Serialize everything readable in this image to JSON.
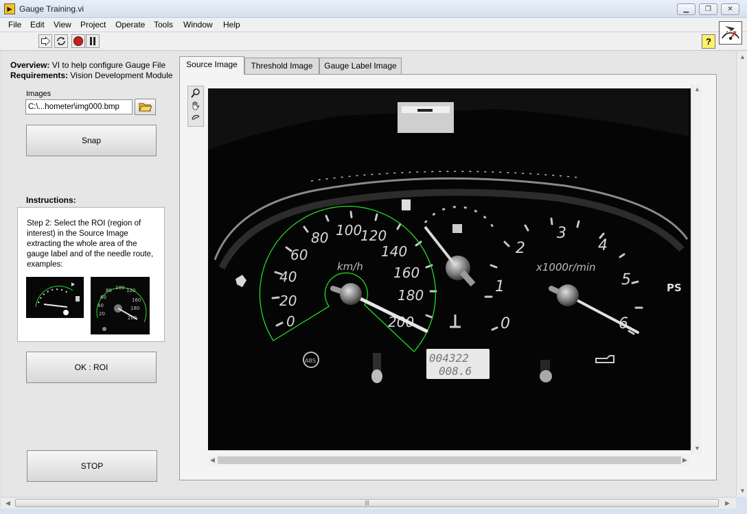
{
  "window": {
    "title": "Gauge Training.vi",
    "app_icon": "labview-icon"
  },
  "menu": [
    "File",
    "Edit",
    "View",
    "Project",
    "Operate",
    "Tools",
    "Window",
    "Help"
  ],
  "toolbar": {
    "buttons": [
      "run-icon",
      "run-continuously-icon",
      "abort-icon",
      "pause-icon"
    ],
    "help_glyph": "?"
  },
  "overview": {
    "overview_label": "Overview:",
    "overview_text": " VI to help configure Gauge File",
    "requirements_label": "Requirements:",
    "requirements_text": " Vision Development Module"
  },
  "images": {
    "label": "Images",
    "path": "C:\\...hometer\\img000.bmp"
  },
  "buttons": {
    "snap": "Snap",
    "ok_roi": "OK : ROI",
    "stop": "STOP"
  },
  "instructions": {
    "title": "Instructions:",
    "text": "Step 2: Select the ROI (region of interest) in the Source Image extracting the whole area of the gauge label and of the needle route, examples:"
  },
  "tabs": [
    {
      "label": "Source Image",
      "active": true
    },
    {
      "label": "Threshold Image",
      "active": false
    },
    {
      "label": "Gauge Label Image",
      "active": false
    }
  ],
  "gauge": {
    "speed_unit": "km/h",
    "speed_ticks": [
      "0",
      "20",
      "40",
      "60",
      "80",
      "100",
      "120",
      "140",
      "160",
      "180",
      "200"
    ],
    "rpm_unit": "x1000r/min",
    "rpm_ticks": [
      "0",
      "1",
      "2",
      "3",
      "4",
      "5",
      "6"
    ],
    "odometer": "004322",
    "trip": "008.6",
    "ps_label": "PS",
    "abs_label": "ABS"
  },
  "colors": {
    "roi": "#22dd22",
    "panel": "#e6e6e6"
  }
}
